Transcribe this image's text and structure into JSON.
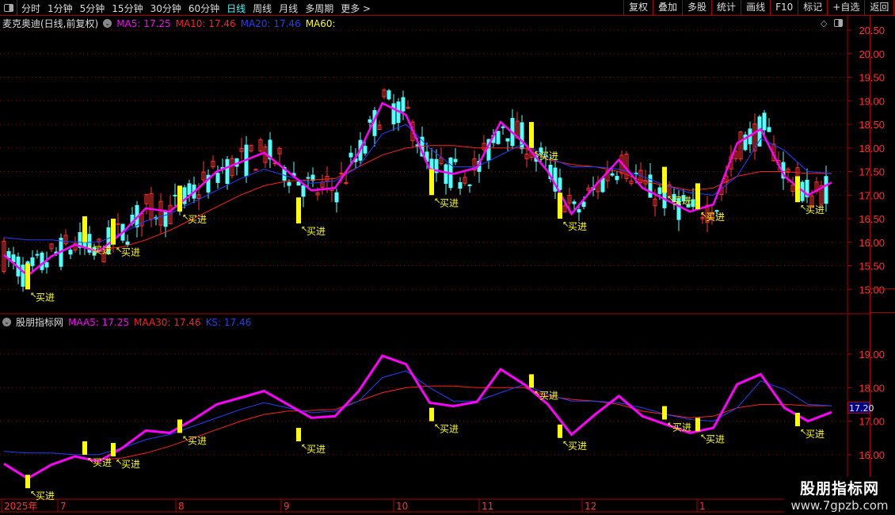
{
  "toolbar": {
    "periods": [
      "分时",
      "1分钟",
      "5分钟",
      "15分钟",
      "30分钟",
      "60分钟",
      "日线",
      "周线",
      "月线",
      "多周期",
      "更多 >"
    ],
    "active_period": "日线",
    "buttons": [
      "复权",
      "叠加",
      "多股",
      "统计",
      "画线",
      "F10",
      "标记",
      "+自选",
      "返回"
    ]
  },
  "main": {
    "title": "麦克奥迪(日线,前复权)",
    "ma": [
      {
        "label": "MA5: 17.25",
        "color": "#ff00ff"
      },
      {
        "label": "MA10: 17.46",
        "color": "#ff2020"
      },
      {
        "label": "MA20: 17.46",
        "color": "#1f3fff"
      },
      {
        "label": "MA60:",
        "color": "#ffff00"
      }
    ],
    "yticks": [
      "20.50",
      "20.00",
      "19.50",
      "19.00",
      "18.50",
      "18.00",
      "17.50",
      "17.00",
      "16.50",
      "16.00",
      "15.50",
      "15.00"
    ]
  },
  "indicator": {
    "title": "股朋指标网",
    "lines": [
      {
        "label": "MAA5: 17.25",
        "color": "#ff00ff"
      },
      {
        "label": "MAA30: 17.46",
        "color": "#ff2020"
      },
      {
        "label": "KS: 17.46",
        "color": "#1f3fff"
      }
    ],
    "yticks": [
      "19.00",
      "18.00",
      "17.00",
      "16.00"
    ],
    "current_value": "17.20"
  },
  "signal_label": "买进",
  "time_axis": [
    "2025年",
    "7",
    "8",
    "9",
    "10",
    "11",
    "12",
    "1"
  ],
  "watermark": {
    "name": "股朋指标网",
    "url": "www.7gpzb.com"
  },
  "chart_data": {
    "type": "line",
    "x_step_days": 5,
    "ma5": [
      15.73,
      15.29,
      15.7,
      15.95,
      15.8,
      16.2,
      16.72,
      16.65,
      17.05,
      17.5,
      17.7,
      17.9,
      17.5,
      17.1,
      17.15,
      17.9,
      18.95,
      18.7,
      17.55,
      17.45,
      17.58,
      18.55,
      18.1,
      17.5,
      16.6,
      17.2,
      17.75,
      17.15,
      16.9,
      16.65,
      16.8,
      18.1,
      18.4,
      17.4,
      17.0,
      17.27
    ],
    "ma20": [
      16.1,
      16.05,
      16.05,
      16.0,
      16.0,
      16.2,
      16.45,
      16.6,
      16.85,
      17.1,
      17.35,
      17.55,
      17.4,
      17.25,
      17.3,
      17.6,
      18.3,
      18.5,
      18.0,
      17.6,
      17.6,
      17.85,
      18.1,
      17.8,
      17.6,
      17.6,
      17.55,
      17.4,
      17.2,
      17.05,
      17.0,
      17.4,
      18.2,
      17.95,
      17.5,
      17.46
    ],
    "ma10": [
      null,
      null,
      null,
      null,
      15.85,
      15.9,
      16.05,
      16.25,
      16.5,
      16.75,
      17.0,
      17.2,
      17.3,
      17.32,
      17.35,
      17.6,
      17.85,
      18.0,
      18.05,
      18.05,
      18.0,
      18.0,
      18.0,
      17.75,
      17.65,
      17.6,
      17.5,
      17.3,
      17.2,
      17.1,
      17.15,
      17.4,
      17.5,
      17.5,
      17.46,
      17.46
    ],
    "signals_day": [
      5,
      17,
      23,
      37,
      62,
      90,
      117,
      111,
      139,
      146,
      167
    ],
    "signals_price": [
      15.0,
      16.0,
      15.95,
      16.65,
      16.4,
      17.0,
      16.5,
      18.0,
      17.05,
      16.7,
      16.85
    ]
  }
}
